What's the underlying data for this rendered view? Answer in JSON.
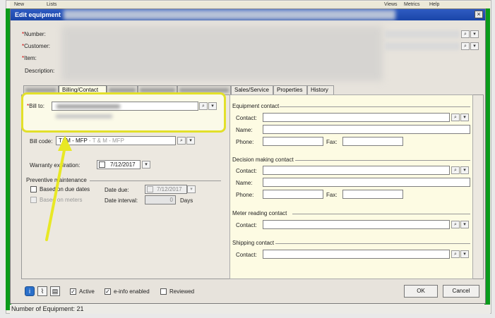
{
  "app": {
    "menu": [
      "New",
      "Lists",
      "Lists",
      "Views",
      "Metrics",
      "Help"
    ],
    "status_text": "Number of Equipment: 21",
    "left_column_chars": [
      "3",
      "3",
      "9",
      "3",
      "9",
      "9",
      "9",
      "9",
      "9",
      "9",
      "9"
    ]
  },
  "dialog": {
    "title": "Edit equipment",
    "close_glyph": "×",
    "fields": {
      "number_label": "Number:",
      "customer_label": "Customer:",
      "item_label": "Item:",
      "description_label": "Description:"
    },
    "tabs": [
      {
        "label": "General",
        "blurred": true
      },
      {
        "label": "Billing/Contact",
        "blurred": false
      },
      {
        "label": "Meters",
        "blurred": true
      },
      {
        "label": "Accessories",
        "blurred": true
      },
      {
        "label": "Contract",
        "blurred": true
      },
      {
        "label": "Sales/Service",
        "blurred": false
      },
      {
        "label": "Properties",
        "blurred": false
      },
      {
        "label": "History",
        "blurred": false
      }
    ],
    "billing": {
      "bill_to_label": "Bill to:",
      "bill_code_label": "Bill code:",
      "bill_code_value": "T&M - MFP",
      "bill_code_desc": " - T & M - MFP",
      "warranty_label": "Warranty expiration:",
      "warranty_date": "7/12/2017",
      "pm_title": "Preventive maintenance",
      "based_on_due_dates": "Based on due dates",
      "based_on_meters": "Based on meters",
      "date_due_label": "Date due:",
      "date_due_value": "7/12/2017",
      "date_interval_label": "Date interval:",
      "date_interval_value": "0",
      "days_label": "Days"
    },
    "contacts": {
      "equipment_contact": "Equipment contact",
      "decision_making_contact": "Decision making contact",
      "meter_reading_contact": "Meter reading contact",
      "shipping_contact": "Shipping contact",
      "contact_label": "Contact:",
      "name_label": "Name:",
      "phone_label": "Phone:",
      "fax_label": "Fax:"
    },
    "footer": {
      "active_label": "Active",
      "active_checked": true,
      "einfo_label": "e-info enabled",
      "einfo_checked": true,
      "reviewed_label": "Reviewed",
      "reviewed_checked": false,
      "ok_label": "OK",
      "cancel_label": "Cancel"
    }
  },
  "colors": {
    "highlight": "#e2e02a",
    "title_bar": "#2f5cc2",
    "green_frame": "#0a9b1b",
    "contact_panel_bg": "#fdfbe3"
  },
  "icons": [
    "lookup-icon",
    "dropdown-icon",
    "info-icon",
    "attach-icon",
    "note-icon",
    "close-icon",
    "calendar-dropdown-icon"
  ]
}
